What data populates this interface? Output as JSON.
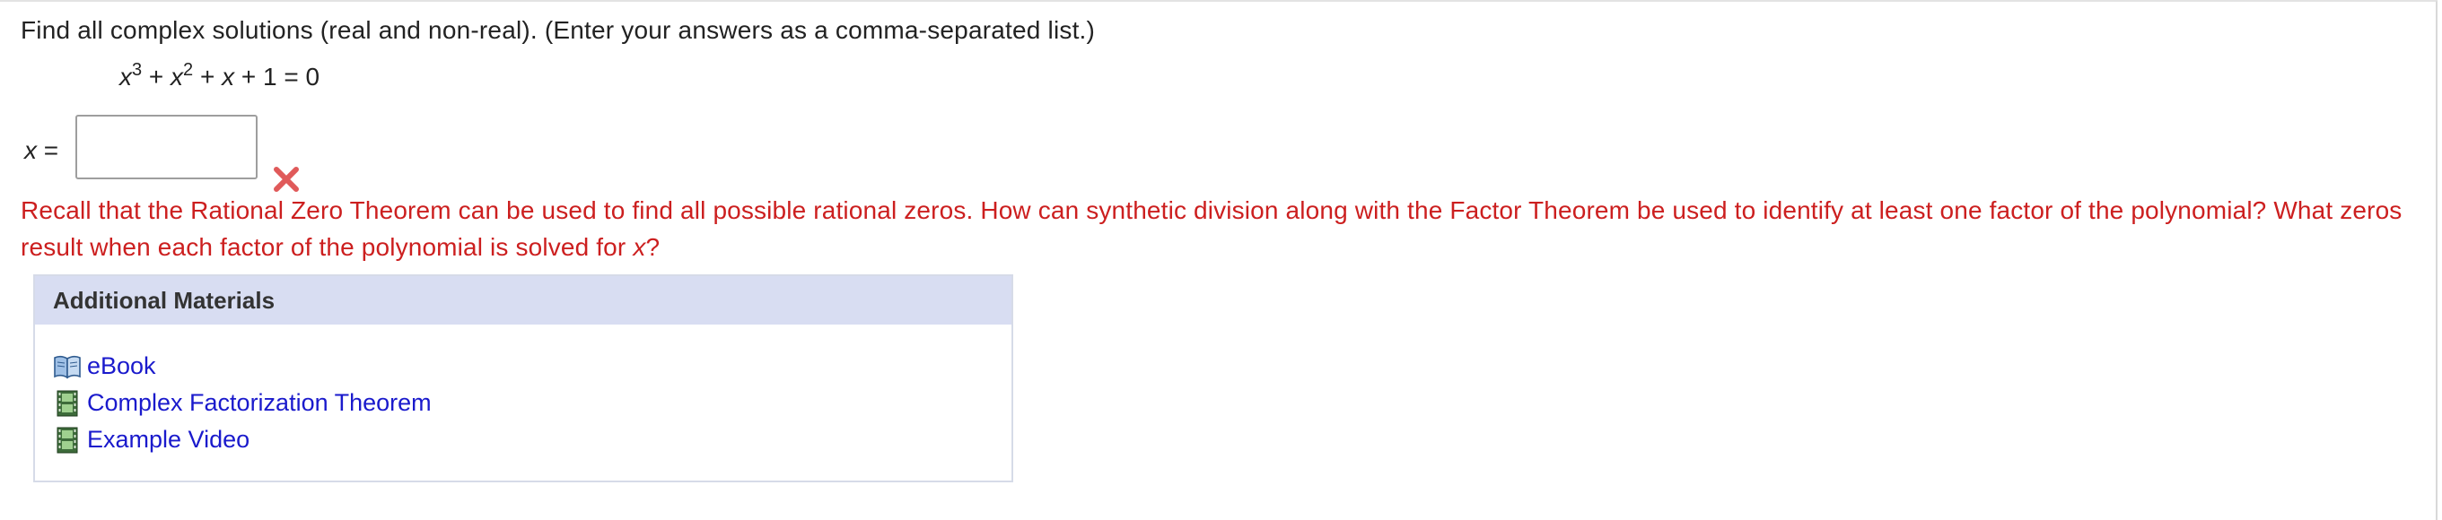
{
  "question": {
    "prompt": "Find all complex solutions (real and non-real). (Enter your answers as a comma-separated list.)",
    "equation": {
      "x": "x",
      "exp3": "3",
      "plus1": " + ",
      "x2": "x",
      "exp2": "2",
      "plus2": " + ",
      "x1": "x",
      "rest": " + 1 = 0"
    }
  },
  "answer": {
    "label_var": "x",
    "label_eq": " =",
    "value": "",
    "placeholder": "",
    "status_icon": "incorrect-x-icon",
    "status_color": "#e05a5a"
  },
  "hint": {
    "text_part1": "Recall that the Rational Zero Theorem can be used to find all possible rational zeros. How can synthetic division along with the Factor Theorem be used to identify at least one factor of the polynomial? What zeros result when each factor of the polynomial is solved for ",
    "var": "x",
    "text_part2": "?",
    "color": "#cc1f1f"
  },
  "additional_materials": {
    "title": "Additional Materials",
    "items": [
      {
        "icon": "book-icon",
        "label": "eBook"
      },
      {
        "icon": "film-icon",
        "label": "Complex Factorization Theorem"
      },
      {
        "icon": "film-icon",
        "label": "Example Video"
      }
    ],
    "header_color": "#d8ddf2",
    "link_color": "#1a1acc"
  }
}
